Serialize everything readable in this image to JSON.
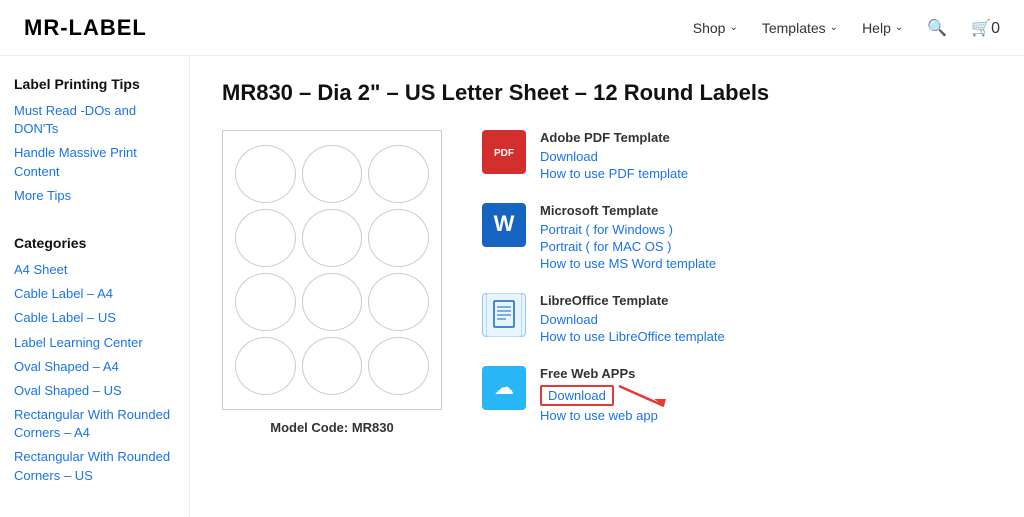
{
  "header": {
    "logo": "MR-LABEL",
    "nav": [
      {
        "label": "Shop",
        "has_dropdown": true
      },
      {
        "label": "Templates",
        "has_dropdown": true
      },
      {
        "label": "Help",
        "has_dropdown": true
      }
    ],
    "cart_label": "0"
  },
  "sidebar": {
    "tips_title": "Label Printing Tips",
    "tips_links": [
      {
        "label": "Must Read -DOs and DON'Ts"
      },
      {
        "label": "Handle Massive Print Content"
      },
      {
        "label": "More Tips"
      }
    ],
    "categories_title": "Categories",
    "categories_links": [
      {
        "label": "A4 Sheet"
      },
      {
        "label": "Cable Label – A4"
      },
      {
        "label": "Cable Label – US"
      },
      {
        "label": "Label Learning Center"
      },
      {
        "label": "Oval Shaped – A4"
      },
      {
        "label": "Oval Shaped – US"
      },
      {
        "label": "Rectangular With Rounded Corners – A4"
      },
      {
        "label": "Rectangular With Rounded Corners – US"
      }
    ]
  },
  "main": {
    "page_title": "MR830 – Dia 2\" – US Letter Sheet – 12 Round Labels",
    "model_code": "Model Code: MR830",
    "label_count": 12,
    "templates": [
      {
        "id": "pdf",
        "name": "Adobe PDF Template",
        "icon_type": "pdf",
        "icon_label": "PDF",
        "links": [
          {
            "label": "Download",
            "highlighted": false
          },
          {
            "label": "How to use PDF template",
            "highlighted": false
          }
        ]
      },
      {
        "id": "word",
        "name": "Microsoft Template",
        "icon_type": "word",
        "icon_label": "W",
        "links": [
          {
            "label": "Portrait ( for Windows )",
            "highlighted": false
          },
          {
            "label": "Portrait ( for MAC OS )",
            "highlighted": false
          },
          {
            "label": "How to use MS Word template",
            "highlighted": false
          }
        ]
      },
      {
        "id": "libre",
        "name": "LibreOffice Template",
        "icon_type": "libre",
        "icon_label": "✎",
        "links": [
          {
            "label": "Download",
            "highlighted": false
          },
          {
            "label": "How to use LibreOffice template",
            "highlighted": false
          }
        ]
      },
      {
        "id": "webapp",
        "name": "Free Web APPs",
        "icon_type": "webapp",
        "icon_label": "☁",
        "links": [
          {
            "label": "Download",
            "highlighted": true
          },
          {
            "label": "How to use web app",
            "highlighted": false
          }
        ]
      }
    ]
  }
}
